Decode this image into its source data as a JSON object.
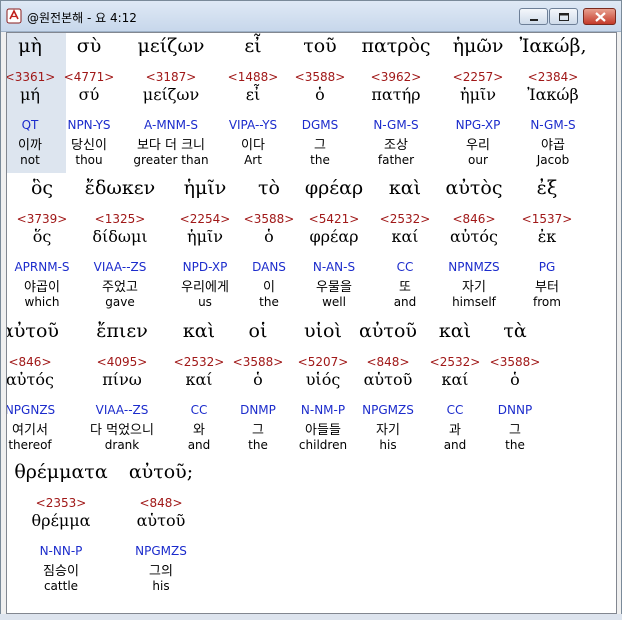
{
  "window": {
    "title": "@원전본해 - 요 4:12"
  },
  "lines": [
    {
      "words": [
        {
          "greek": "μὴ",
          "strong": "<3361>",
          "lemma": "μή",
          "parse": "QT",
          "korean": "이까",
          "english": "not"
        },
        {
          "greek": "σὺ",
          "strong": "<4771>",
          "lemma": "σύ",
          "parse": "NPN-YS",
          "korean": "당신이",
          "english": "thou"
        },
        {
          "greek": "μείζων",
          "strong": "<3187>",
          "lemma": "μείζων",
          "parse": "A-MNM-S",
          "korean": "보다 더 크니",
          "english": "greater than"
        },
        {
          "greek": "εἶ",
          "strong": "<1488>",
          "lemma": "εἶ",
          "parse": "VIPA--YS",
          "korean": "이다",
          "english": "Art"
        },
        {
          "greek": "τοῦ",
          "strong": "<3588>",
          "lemma": "ὁ",
          "parse": "DGMS",
          "korean": "그",
          "english": "the"
        },
        {
          "greek": "πατρὸς",
          "strong": "<3962>",
          "lemma": "πατήρ",
          "parse": "N-GM-S",
          "korean": "조상",
          "english": "father"
        },
        {
          "greek": "ἡμῶν",
          "strong": "<2257>",
          "lemma": "ἡμῖν",
          "parse": "NPG-XP",
          "korean": "우리",
          "english": "our"
        },
        {
          "greek": "Ἰακώβ,",
          "strong": "<2384>",
          "lemma": "Ἰακώβ",
          "parse": "N-GM-S",
          "korean": "야곱",
          "english": "Jacob"
        }
      ]
    },
    {
      "words": [
        {
          "greek": "ὃς",
          "strong": "<3739>",
          "lemma": "ὅς",
          "parse": "APRNM-S",
          "korean": "야곱이",
          "english": "which"
        },
        {
          "greek": "ἔδωκεν",
          "strong": "<1325>",
          "lemma": "δίδωμι",
          "parse": "VIAA--ZS",
          "korean": "주었고",
          "english": "gave"
        },
        {
          "greek": "ἡμῖν",
          "strong": "<2254>",
          "lemma": "ἡμῖν",
          "parse": "NPD-XP",
          "korean": "우리에게",
          "english": "us"
        },
        {
          "greek": "τὸ",
          "strong": "<3588>",
          "lemma": "ὁ",
          "parse": "DANS",
          "korean": "이",
          "english": "the"
        },
        {
          "greek": "φρέαρ",
          "strong": "<5421>",
          "lemma": "φρέαρ",
          "parse": "N-AN-S",
          "korean": "우물을",
          "english": "well"
        },
        {
          "greek": "καὶ",
          "strong": "<2532>",
          "lemma": "καί",
          "parse": "CC",
          "korean": "또",
          "english": "and"
        },
        {
          "greek": "αὐτὸς",
          "strong": "<846>",
          "lemma": "αὐτός",
          "parse": "NPNMZS",
          "korean": "자기",
          "english": "himself"
        },
        {
          "greek": "ἐξ",
          "strong": "<1537>",
          "lemma": "ἐκ",
          "parse": "PG",
          "korean": "부터",
          "english": "from"
        }
      ]
    },
    {
      "words": [
        {
          "greek": "αὐτοῦ",
          "strong": "<846>",
          "lemma": "αὐτός",
          "parse": "NPGNZS",
          "korean": "여기서",
          "english": "thereof"
        },
        {
          "greek": "ἔπιεν",
          "strong": "<4095>",
          "lemma": "πίνω",
          "parse": "VIAA--ZS",
          "korean": "다 먹었으니",
          "english": "drank"
        },
        {
          "greek": "καὶ",
          "strong": "<2532>",
          "lemma": "καί",
          "parse": "CC",
          "korean": "와",
          "english": "and"
        },
        {
          "greek": "οἱ",
          "strong": "<3588>",
          "lemma": "ὁ",
          "parse": "DNMP",
          "korean": "그",
          "english": "the"
        },
        {
          "greek": "υἱοὶ",
          "strong": "<5207>",
          "lemma": "υἱός",
          "parse": "N-NM-P",
          "korean": "아들들",
          "english": "children"
        },
        {
          "greek": "αὐτοῦ",
          "strong": "<848>",
          "lemma": "αὑτοῦ",
          "parse": "NPGMZS",
          "korean": "자기",
          "english": "his"
        },
        {
          "greek": "καὶ",
          "strong": "<2532>",
          "lemma": "καί",
          "parse": "CC",
          "korean": "과",
          "english": "and"
        },
        {
          "greek": "τὰ",
          "strong": "<3588>",
          "lemma": "ὁ",
          "parse": "DNNP",
          "korean": "그",
          "english": "the"
        }
      ]
    },
    {
      "words": [
        {
          "greek": "θρέμματα",
          "strong": "<2353>",
          "lemma": "θρέμμα",
          "parse": "N-NN-P",
          "korean": "짐승이",
          "english": "cattle"
        },
        {
          "greek": "αὐτοῦ;",
          "strong": "<848>",
          "lemma": "αὑτοῦ",
          "parse": "NPGMZS",
          "korean": "그의",
          "english": "his"
        }
      ]
    }
  ]
}
